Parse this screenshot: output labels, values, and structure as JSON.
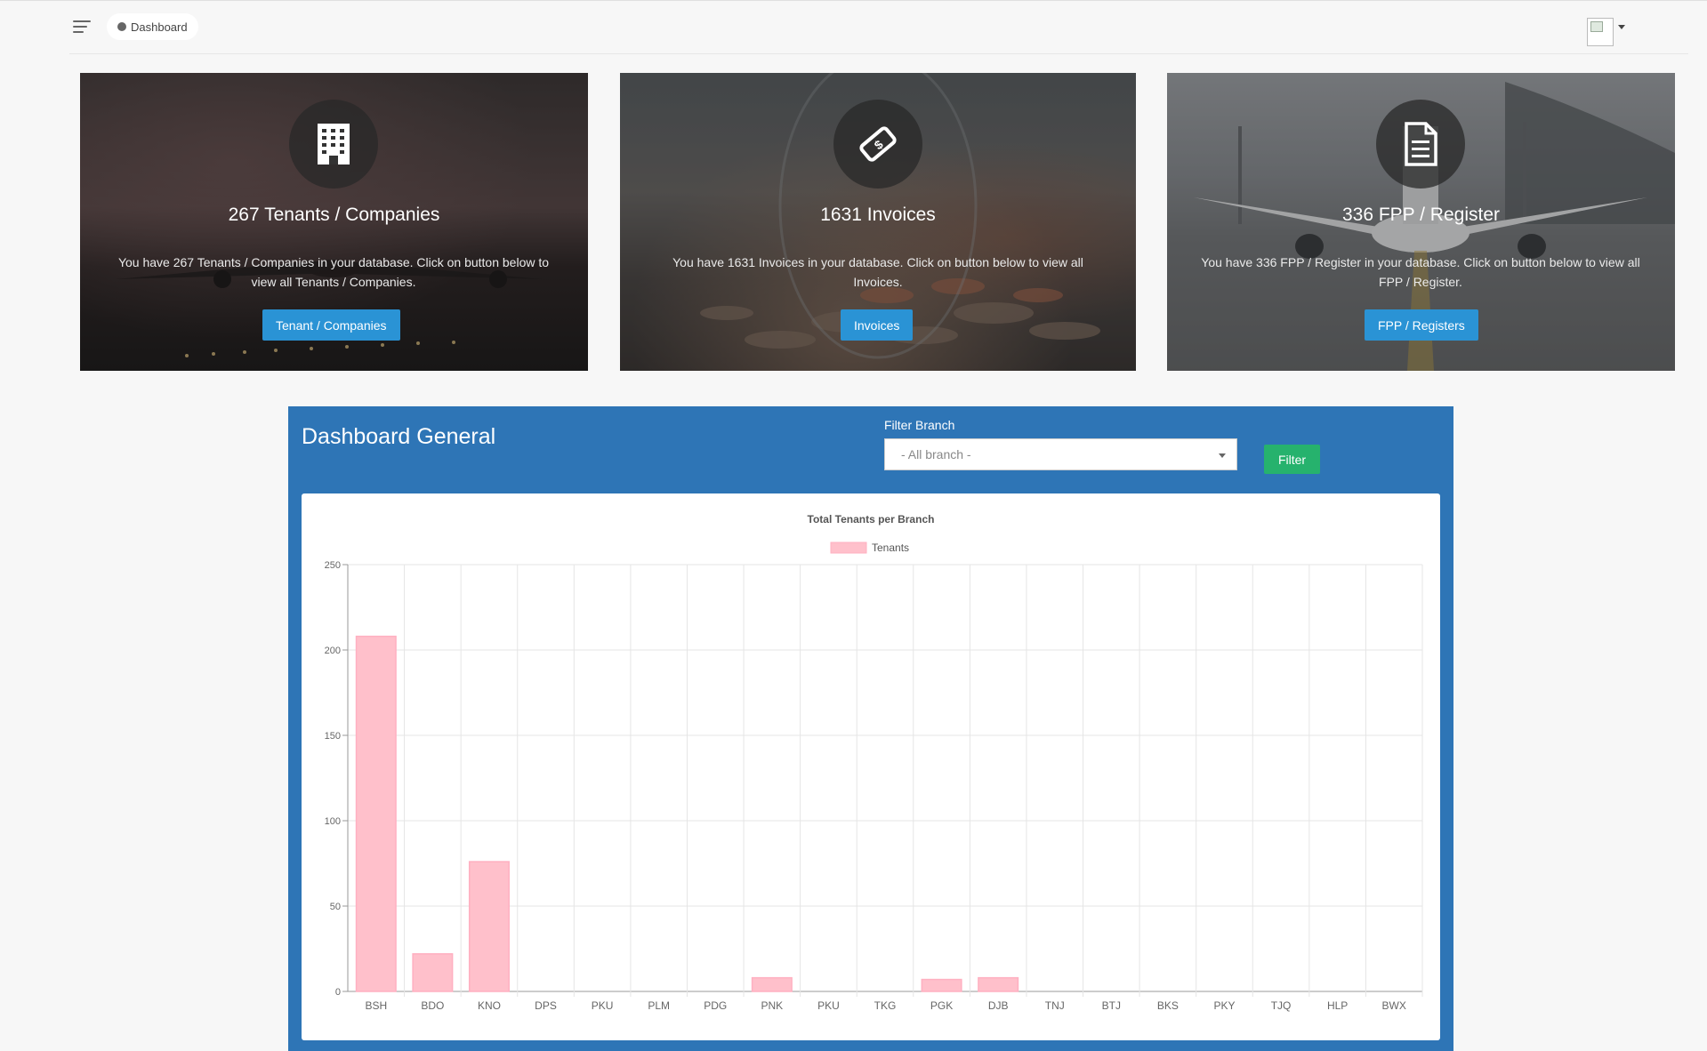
{
  "topbar": {
    "breadcrumb": "Dashboard"
  },
  "cards": [
    {
      "title": "267 Tenants / Companies",
      "description": "You have 267 Tenants / Companies in your database. Click on button below to view all Tenants / Companies.",
      "button": "Tenant / Companies",
      "icon": "building-icon"
    },
    {
      "title": "1631 Invoices",
      "description": "You have 1631 Invoices in your database. Click on button below to view all Invoices.",
      "button": "Invoices",
      "icon": "money-icon"
    },
    {
      "title": "336 FPP / Register",
      "description": "You have 336 FPP / Register in your database. Click on button below to view all FPP / Register.",
      "button": "FPP / Registers",
      "icon": "document-icon"
    }
  ],
  "dashboard": {
    "title": "Dashboard General",
    "filter_label": "Filter Branch",
    "filter_value": "- All branch -",
    "filter_button": "Filter"
  },
  "colors": {
    "panel": "#2e75b6",
    "button_blue": "#2a93d5",
    "button_green": "#26b26d",
    "bar_fill": "#ffc0cb",
    "bar_stroke": "#ffb0c1"
  },
  "chart_data": {
    "type": "bar",
    "title": "Total Tenants per Branch",
    "legend": "top",
    "categories": [
      "BSH",
      "BDO",
      "KNO",
      "DPS",
      "PKU",
      "PLM",
      "PDG",
      "PNK",
      "PKU",
      "TKG",
      "PGK",
      "DJB",
      "TNJ",
      "BTJ",
      "BKS",
      "PKY",
      "TJQ",
      "HLP",
      "BWX"
    ],
    "series": [
      {
        "name": "Tenants",
        "values": [
          208,
          22,
          76,
          0,
          0,
          0,
          0,
          8,
          0,
          0,
          7,
          8,
          0,
          0,
          0,
          0,
          0,
          0,
          0
        ]
      }
    ],
    "ylim": [
      0,
      250
    ],
    "yticks": [
      0,
      50,
      100,
      150,
      200,
      250
    ],
    "grid": true
  }
}
